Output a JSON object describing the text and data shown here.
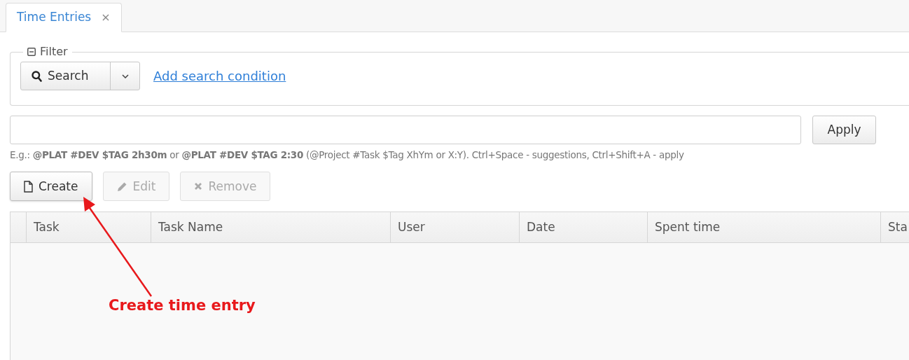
{
  "tabs": [
    {
      "label": "Time Entries",
      "close": "×",
      "selected": true
    }
  ],
  "filter": {
    "title": "Filter",
    "expanded": true,
    "search_button": "Search",
    "link": "Add search condition"
  },
  "quick_entry": {
    "button": "Apply",
    "hint": "E.g.: **@PLAT #DEV $TAG 2h30m** or **@PLAT #DEV $TAG 2:30** (@Project #Task $Tag XhYm or X:Y). Ctrl+Space - suggestions, Ctrl+Shift+A - apply"
  },
  "toolbar": [
    {
      "kind": "create",
      "label": "Create",
      "disabled": false
    },
    {
      "kind": "edit",
      "label": "Edit",
      "disabled": true
    },
    {
      "kind": "remove",
      "label": "Remove",
      "disabled": true
    }
  ],
  "table": {
    "columns": [
      "Task",
      "Task Name",
      "User",
      "Date",
      "Spent time",
      "Sta"
    ]
  },
  "annotation": {
    "text": "Create time entry"
  }
}
